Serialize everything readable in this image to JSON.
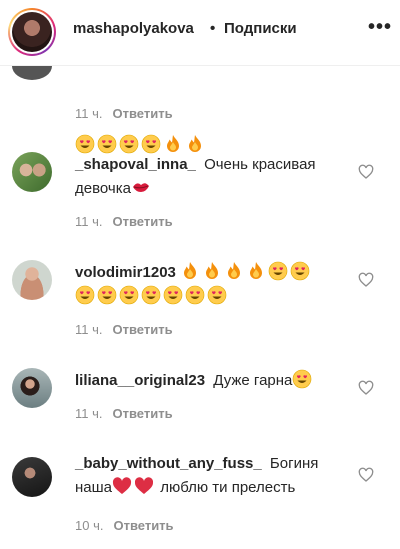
{
  "header": {
    "username": "mashapolyakova",
    "separator": "•",
    "follow_label": "Подписки",
    "more": "•••"
  },
  "top_partial": {
    "emojis": [
      "heart-eyes",
      "heart-eyes",
      "heart-eyes",
      "heart-eyes",
      "fire",
      "fire"
    ],
    "time": "11 ч.",
    "reply": "Ответить"
  },
  "comments": [
    {
      "username": "_shapoval_inna_",
      "text_lines": [
        "Очень красивая",
        "девочка"
      ],
      "trailing_emoji": "lips",
      "time": "11 ч.",
      "reply": "Ответить"
    },
    {
      "username": "volodimir1203",
      "emojis_line1": [
        "fire",
        "fire",
        "fire",
        "fire",
        "heart-eyes",
        "heart-eyes"
      ],
      "emojis_line2": [
        "heart-eyes",
        "heart-eyes",
        "heart-eyes",
        "heart-eyes",
        "heart-eyes",
        "heart-eyes",
        "heart-eyes"
      ],
      "time": "11 ч.",
      "reply": "Ответить"
    },
    {
      "username": "liliana__original23",
      "text": "Дуже гарна",
      "trailing_emoji": "heart-eyes",
      "time": "11 ч.",
      "reply": "Ответить"
    },
    {
      "username": "_baby_without_any_fuss_",
      "text_line1": "Богиня",
      "text_line2_start": "наша",
      "text_line2_end": "люблю ти прелесть",
      "emojis": [
        "red-heart",
        "red-heart"
      ],
      "time": "10 ч.",
      "reply": "Ответить"
    }
  ],
  "colors": {
    "text": "#262626",
    "muted": "#8e8e8e",
    "border": "#efefef"
  }
}
